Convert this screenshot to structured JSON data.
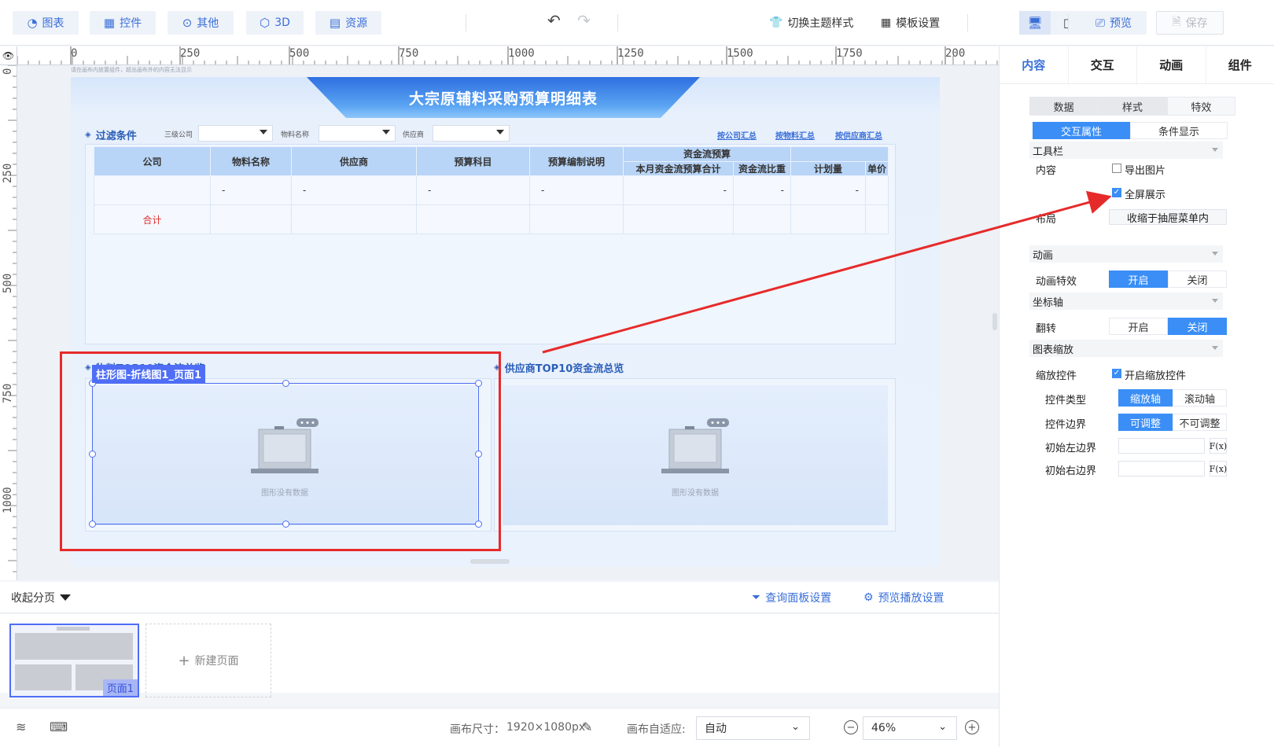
{
  "toolbar": {
    "chart": "图表",
    "widget": "控件",
    "other": "其他",
    "three_d": "3D",
    "resource": "资源",
    "switch_theme": "切换主题样式",
    "template_settings": "模板设置",
    "preview": "预览",
    "save": "保存"
  },
  "ruler": {
    "h_labels": [
      "0",
      "250",
      "500",
      "750",
      "1000",
      "1250",
      "1500",
      "1750",
      "200"
    ],
    "v_labels": [
      "0",
      "250",
      "500",
      "750",
      "1000"
    ]
  },
  "canvas": {
    "hint": "请在画布内放置组件，超出画布外的内容无法显示",
    "board_title": "大宗原辅料采购预算明细表",
    "filter": {
      "label": "过滤条件",
      "fields": [
        "三级公司",
        "物料名称",
        "供应商"
      ],
      "links": [
        "按公司汇总",
        "按物料汇总",
        "按供应商汇总"
      ]
    },
    "table": {
      "headers": [
        "公司",
        "物料名称",
        "供应商",
        "预算科目",
        "预算编制说明"
      ],
      "group_header": "资金流预算",
      "sub_headers": [
        "本月资金流预算合计",
        "资金流比重",
        "计划量",
        "单价"
      ],
      "row1": [
        "",
        "-",
        "-",
        "-",
        "-",
        "-",
        "-",
        "-",
        ""
      ],
      "total_label": "合计"
    },
    "chart_left": {
      "title": "物料TOP10资金流总览",
      "empty": "图形没有数据",
      "selection_tag": "柱形图-折线图1_页面1"
    },
    "chart_right": {
      "title": "供应商TOP10资金流总览",
      "empty": "图形没有数据"
    }
  },
  "pages": {
    "collapse": "收起分页",
    "query_panel": "查询面板设置",
    "preview_play": "预览播放设置",
    "page_tag": "页面1",
    "new_page": "新建页面"
  },
  "status": {
    "canvas_size_label": "画布尺寸：",
    "canvas_size_value": "1920×1080px",
    "adapt_label": "画布自适应:",
    "adapt_value": "自动",
    "zoom": "46%"
  },
  "panel": {
    "tabs": [
      "内容",
      "交互",
      "动画",
      "组件"
    ],
    "sub_tabs": [
      "数据",
      "样式",
      "特效"
    ],
    "interact_tabs": [
      "交互属性",
      "条件显示"
    ],
    "toolbar_section": "工具栏",
    "content_label": "内容",
    "export_image": "导出图片",
    "fullscreen": "全屏展示",
    "layout_label": "布局",
    "collapse_drawer": "收缩于抽屉菜单内",
    "animation_section": "动画",
    "anim_effect_label": "动画特效",
    "on": "开启",
    "off": "关闭",
    "axis_section": "坐标轴",
    "flip_label": "翻转",
    "zoom_section": "图表缩放",
    "zoom_control_label": "缩放控件",
    "enable_zoom": "开启缩放控件",
    "control_type_label": "控件类型",
    "zoom_axis": "缩放轴",
    "scroll_axis": "滚动轴",
    "control_border_label": "控件边界",
    "adjustable": "可调整",
    "not_adjustable": "不可调整",
    "init_left_label": "初始左边界",
    "init_right_label": "初始右边界",
    "fx": "F(x)"
  }
}
